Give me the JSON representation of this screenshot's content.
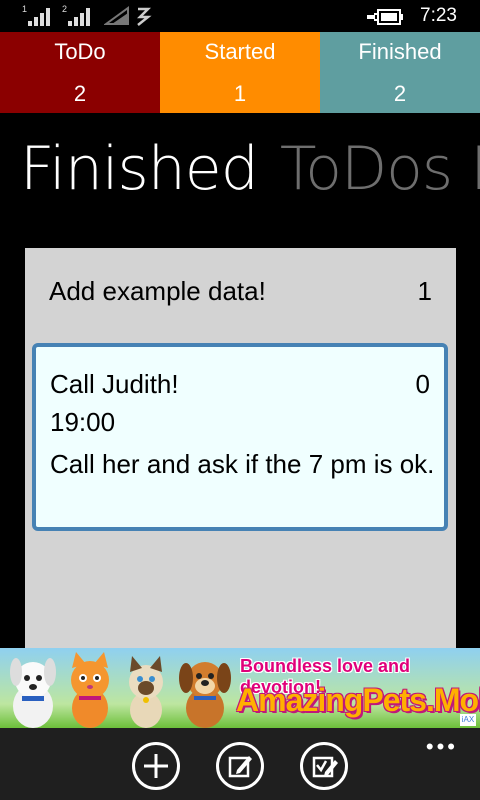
{
  "status": {
    "sim1": "1",
    "sim2": "2",
    "time": "7:23"
  },
  "counters": [
    {
      "label": "ToDo",
      "count": "2",
      "color": "#8b0000"
    },
    {
      "label": "Started",
      "count": "1",
      "color": "#ff8c00"
    },
    {
      "label": "Finished",
      "count": "2",
      "color": "#5f9ea0"
    }
  ],
  "pivot": {
    "active": "Finished",
    "next": "ToDos I"
  },
  "items": [
    {
      "title": "Add example data!",
      "number": "1"
    },
    {
      "title": "Call Judith!",
      "number": "0",
      "time": "19:00",
      "description": "Call her and ask if the 7 pm is ok."
    }
  ],
  "ad": {
    "tagline": "Boundless love and devotion!",
    "brand": "AmazingPets.Mobi",
    "badge": "iAX"
  },
  "appbar": {
    "buttons": [
      "add-icon",
      "edit-icon",
      "check-edit-icon"
    ],
    "more": "•••"
  }
}
